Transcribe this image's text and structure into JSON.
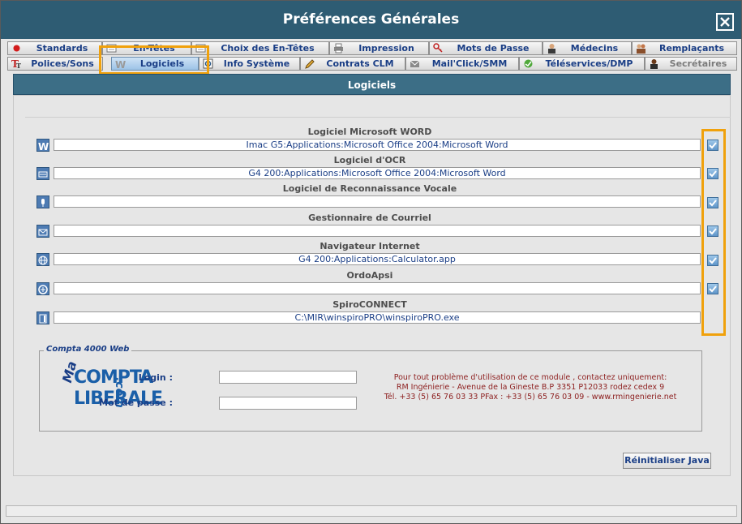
{
  "window": {
    "title": "Préférences Générales"
  },
  "tabs": {
    "row1": [
      {
        "label": "Standards",
        "icon": "red-dot-icon"
      },
      {
        "label": "En-Têtes",
        "icon": "document-icon"
      },
      {
        "label": "Choix des En-Têtes",
        "icon": "document-icon"
      },
      {
        "label": "Impression",
        "icon": "printer-icon"
      },
      {
        "label": "Mots de Passe",
        "icon": "key-icon"
      },
      {
        "label": "Médecins",
        "icon": "doctor-icon"
      },
      {
        "label": "Remplaçants",
        "icon": "people-icon"
      }
    ],
    "row2": [
      {
        "label": "Polices/Sons",
        "icon": "font-icon"
      },
      {
        "label": "Logiciels",
        "icon": "word-icon"
      },
      {
        "label": "Info Système",
        "icon": "system-icon"
      },
      {
        "label": "Contrats CLM",
        "icon": "pencil-icon"
      },
      {
        "label": "Mail'Click/SMM",
        "icon": "mail-icon"
      },
      {
        "label": "Téléservices/DMP",
        "icon": "green-ball-icon"
      },
      {
        "label": "Secrétaires",
        "icon": "secretary-icon"
      }
    ]
  },
  "section": {
    "title": "Logiciels"
  },
  "software": [
    {
      "label": "Logiciel Microsoft WORD",
      "value": "Imac G5:Applications:Microsoft Office 2004:Microsoft Word",
      "icon": "word-icon"
    },
    {
      "label": "Logiciel d'OCR",
      "value": "G4 200:Applications:Microsoft Office 2004:Microsoft Word",
      "icon": "scanner-icon"
    },
    {
      "label": "Logiciel de Reconnaissance Vocale",
      "value": "",
      "icon": "microphone-icon"
    },
    {
      "label": "Gestionnaire de Courriel",
      "value": "",
      "icon": "envelope-icon"
    },
    {
      "label": "Navigateur Internet",
      "value": "G4 200:Applications:Calculator.app",
      "icon": "globe-icon"
    },
    {
      "label": "OrdoApsi",
      "value": "",
      "icon": "ordo-icon"
    },
    {
      "label": "SpiroCONNECT",
      "value": "C:\\MIR\\winspiroPRO\\winspiroPRO.exe",
      "icon": "spiro-icon"
    }
  ],
  "compta": {
    "legend": "Compta 4000 Web",
    "logo_ma": "Ma",
    "logo_compta": "COMPTA",
    "logo_liberale": "LIBERALE",
    "logo_com": ".com",
    "login_label": "Login :",
    "password_label": "Mot de passe :",
    "support_line1": "Pour tout problème d'utilisation de ce module , contactez uniquement:",
    "support_line2": "RM Ingénierie - Avenue de la Gineste B.P 3351 P12033 rodez cedex 9",
    "support_line3": "Tél. +33 (5) 65 76 03 33 PFax : +33 (5) 65 76 03 09 - www.rmingenierie.net"
  },
  "buttons": {
    "reset_java": "Réinitialiser Java"
  },
  "colors": {
    "titlebar": "#2e5c73",
    "accent": "#1a3e86",
    "highlight": "#f0a10c"
  }
}
